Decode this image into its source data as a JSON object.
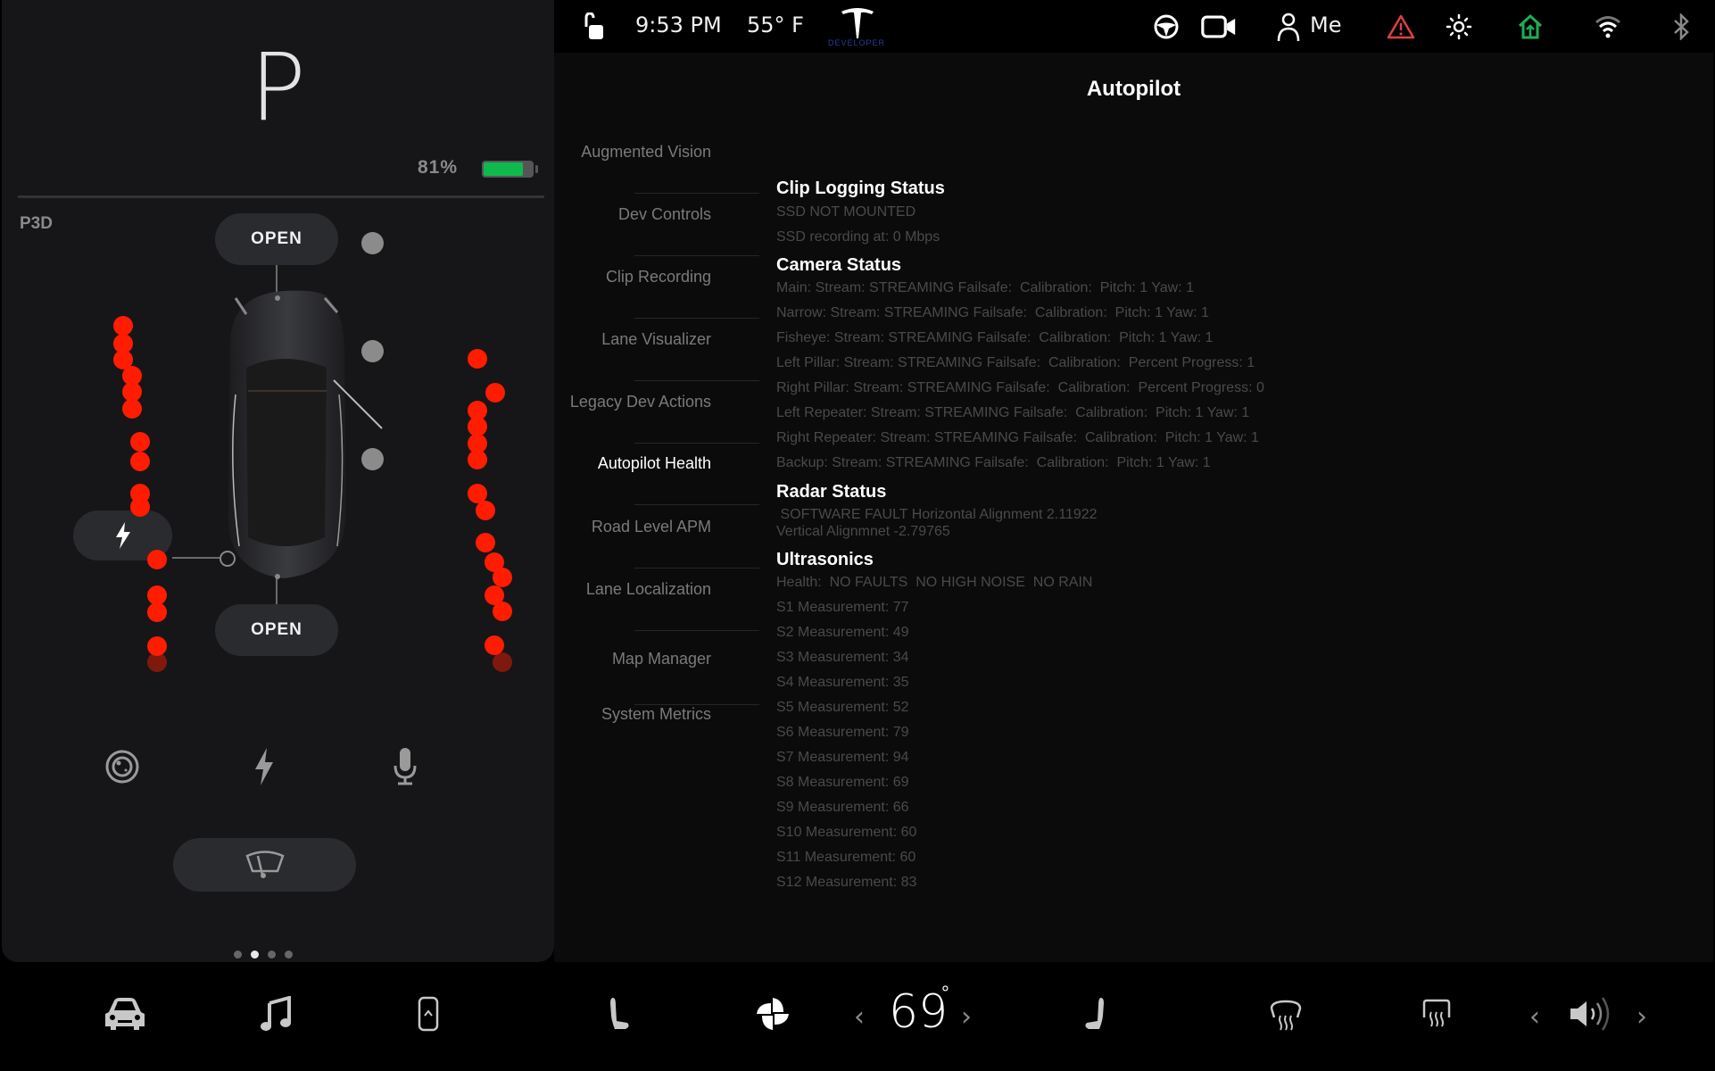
{
  "vehicle": {
    "gear": "P",
    "battery_percent_label": "81%",
    "battery_level": 0.81,
    "model": "P3D",
    "frunk_button": "OPEN",
    "trunk_button": "OPEN",
    "page_indicator": {
      "count": 4,
      "active_index": 1
    }
  },
  "statusbar": {
    "time": "9:53 PM",
    "temperature": "55° F",
    "logo_label": "DEVELOPER",
    "profile_name": "Me",
    "colors": {
      "warning": "#e04040",
      "home": "#1fae55",
      "developer": "#2a3a9a"
    }
  },
  "panel": {
    "title": "Autopilot",
    "nav": [
      {
        "label": "Augmented Vision",
        "active": false
      },
      {
        "label": "Dev Controls",
        "active": false
      },
      {
        "label": "Clip Recording",
        "active": false
      },
      {
        "label": "Lane Visualizer",
        "active": false
      },
      {
        "label": "Legacy Dev Actions",
        "active": false
      },
      {
        "label": "Autopilot Health",
        "active": true
      },
      {
        "label": "Road Level APM",
        "active": false
      },
      {
        "label": "Lane Localization",
        "active": false
      },
      {
        "label": "Map Manager",
        "active": false
      },
      {
        "label": "System Metrics",
        "active": false
      }
    ],
    "sections": {
      "clip_logging": {
        "title": "Clip Logging Status",
        "lines": [
          "SSD NOT MOUNTED",
          "SSD recording at: 0 Mbps"
        ]
      },
      "camera": {
        "title": "Camera Status",
        "lines": [
          "Main: Stream: STREAMING Failsafe:  Calibration:  Pitch: 1 Yaw: 1",
          "Narrow: Stream: STREAMING Failsafe:  Calibration:  Pitch: 1 Yaw: 1",
          "Fisheye: Stream: STREAMING Failsafe:  Calibration:  Pitch: 1 Yaw: 1",
          "Left Pillar: Stream: STREAMING Failsafe:  Calibration:  Percent Progress: 1",
          "Right Pillar: Stream: STREAMING Failsafe:  Calibration:  Percent Progress: 0",
          "Left Repeater: Stream: STREAMING Failsafe:  Calibration:  Pitch: 1 Yaw: 1",
          "Right Repeater: Stream: STREAMING Failsafe:  Calibration:  Pitch: 1 Yaw: 1",
          "Backup: Stream: STREAMING Failsafe:  Calibration:  Pitch: 1 Yaw: 1"
        ]
      },
      "radar": {
        "title": "Radar Status",
        "lines": [
          " SOFTWARE FAULT Horizontal Alignment 2.11922",
          "Vertical Alignmnet -2.79765"
        ]
      },
      "ultrasonics": {
        "title": "Ultrasonics",
        "lines": [
          "Health:  NO FAULTS  NO HIGH NOISE  NO RAIN",
          "S1 Measurement: 77",
          "S2 Measurement: 49",
          "S3 Measurement: 34",
          "S4 Measurement: 35",
          "S5 Measurement: 52",
          "S6 Measurement: 79",
          "S7 Measurement: 94",
          "S8 Measurement: 69",
          "S9 Measurement: 66",
          "S10 Measurement: 60",
          "S11 Measurement: 60",
          "S12 Measurement: 83"
        ]
      }
    }
  },
  "bottombar": {
    "temperature": "69",
    "temperature_unit": "°"
  }
}
